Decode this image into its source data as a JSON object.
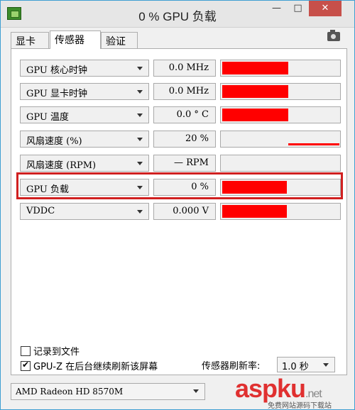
{
  "window": {
    "title": "0 % GPU 负载",
    "minimize_label": "—",
    "maximize_label": "□",
    "close_label": "✕"
  },
  "tabs": [
    {
      "label": "显卡",
      "active": false
    },
    {
      "label": "传感器",
      "active": true
    },
    {
      "label": "验证",
      "active": false
    }
  ],
  "icons": {
    "camera": "camera-icon",
    "app": "gpu-z-app-icon"
  },
  "colors": {
    "graph_fill": "#ff0000",
    "highlight": "#d02020"
  },
  "sensors": [
    {
      "name": "GPU 核心时钟",
      "value": "0.0 MHz",
      "level": 0.56
    },
    {
      "name": "GPU 显卡时钟",
      "value": "0.0 MHz",
      "level": 0.56
    },
    {
      "name": "GPU 温度",
      "value": "0.0 ° C",
      "level": 0.56
    },
    {
      "name": "风扇速度 (%)",
      "value": "20 %",
      "line": true
    },
    {
      "name": "风扇速度 (RPM)",
      "value": "— RPM",
      "level": 0
    },
    {
      "name": "GPU 负载",
      "value": "0 %",
      "level": 0.55
    },
    {
      "name": "VDDC",
      "value": "0.000 V",
      "level": 0.55
    }
  ],
  "options": {
    "log_to_file": {
      "label": "记录到文件",
      "checked": false
    },
    "continue_bg": {
      "label": "GPU-Z 在后台继续刷新该屏幕",
      "checked": true
    }
  },
  "refresh": {
    "label": "传感器刷新率:",
    "value": "1.0 秒"
  },
  "gpu_select": {
    "value": "AMD Radeon HD 8570M"
  },
  "watermark": {
    "brand": "aspku",
    "tld": ".net",
    "sub": "免费网站源码下载站"
  }
}
